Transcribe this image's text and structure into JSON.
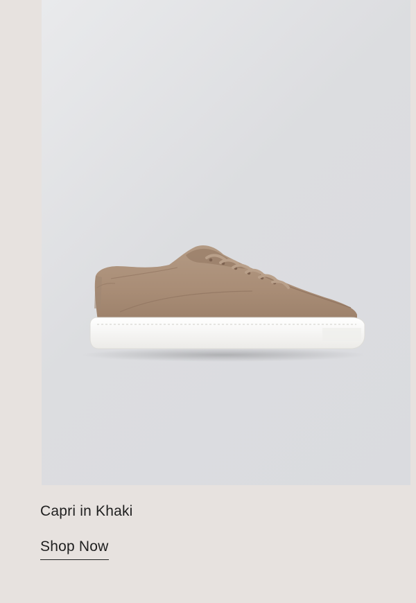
{
  "product": {
    "name": "Capri in Khaki",
    "image_description": "khaki leather low-top sneaker with white sole",
    "colors": {
      "background": "#e7e2df",
      "panel": "#dcdde0",
      "leather": "#a98d76",
      "sole": "#f4f4f2",
      "text": "#1f1f1f"
    }
  },
  "cta": {
    "label": "Shop Now"
  }
}
